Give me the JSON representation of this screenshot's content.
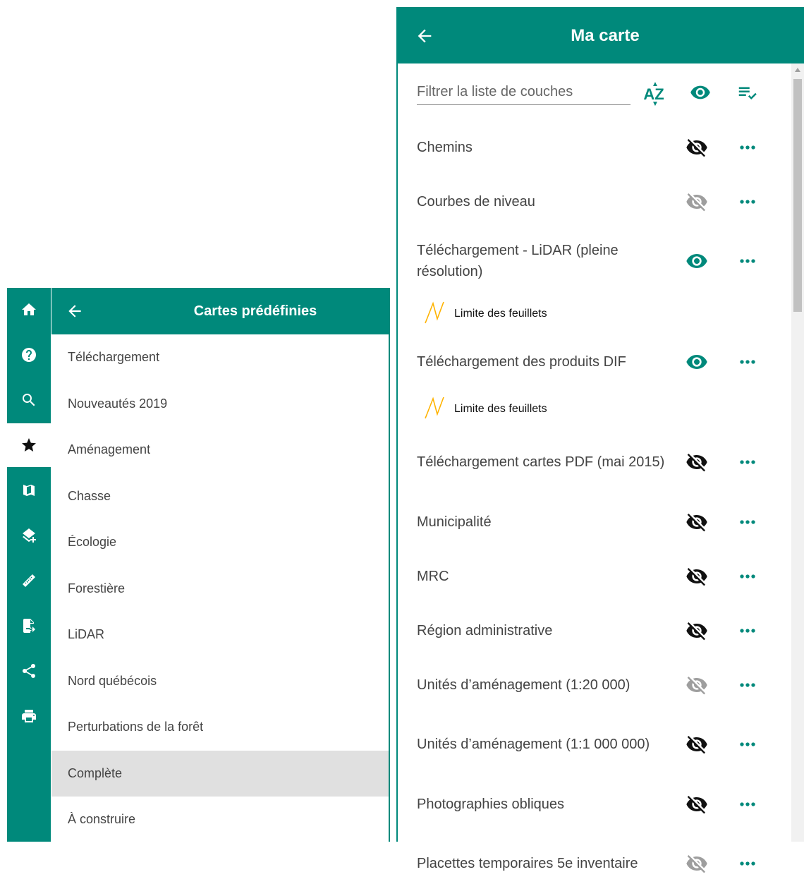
{
  "rail": {
    "items": [
      {
        "icon": "home-icon",
        "active": false
      },
      {
        "icon": "help-icon",
        "active": false
      },
      {
        "icon": "search-icon",
        "active": false
      },
      {
        "icon": "star-icon",
        "active": true
      },
      {
        "icon": "map-icon",
        "active": false
      },
      {
        "icon": "add-layer-icon",
        "active": false
      },
      {
        "icon": "ruler-icon",
        "active": false
      },
      {
        "icon": "export-file-icon",
        "active": false
      },
      {
        "icon": "share-icon",
        "active": false
      },
      {
        "icon": "print-icon",
        "active": false
      }
    ]
  },
  "predefined": {
    "title": "Cartes prédéfinies",
    "items": [
      {
        "label": "Téléchargement"
      },
      {
        "label": "Nouveautés 2019"
      },
      {
        "label": "Aménagement"
      },
      {
        "label": "Chasse"
      },
      {
        "label": "Écologie"
      },
      {
        "label": "Forestière"
      },
      {
        "label": "LiDAR"
      },
      {
        "label": "Nord québécois"
      },
      {
        "label": "Perturbations de la forêt"
      },
      {
        "label": "Complète",
        "selected": true
      },
      {
        "label": "À construire"
      }
    ]
  },
  "mymap": {
    "title": "Ma carte",
    "filter_placeholder": "Filtrer la liste de couches",
    "sort_label": "AZ",
    "layers": [
      {
        "name": "Chemins",
        "visibility": "hidden"
      },
      {
        "name": "Courbes de niveau",
        "visibility": "disabled"
      },
      {
        "name": "Téléchargement - LiDAR (pleine résolution)",
        "visibility": "visible",
        "legend": "Limite des feuillets"
      },
      {
        "name": "Téléchargement des produits DIF",
        "visibility": "visible",
        "legend": "Limite des feuillets"
      },
      {
        "name": "Téléchargement cartes PDF (mai 2015)",
        "visibility": "hidden"
      },
      {
        "name": "Municipalité",
        "visibility": "hidden"
      },
      {
        "name": "MRC",
        "visibility": "hidden"
      },
      {
        "name": "Région administrative",
        "visibility": "hidden"
      },
      {
        "name": "Unités d’aménagement (1:20 000)",
        "visibility": "disabled"
      },
      {
        "name": "Unités d’aménagement (1:1 000 000)",
        "visibility": "hidden"
      },
      {
        "name": "Photographies obliques",
        "visibility": "hidden"
      },
      {
        "name": "Placettes temporaires 5e inventaire",
        "visibility": "disabled"
      }
    ]
  },
  "colors": {
    "accent": "#00897b",
    "hidden_icon": "#111111",
    "disabled_icon": "#9e9e9e",
    "legend_line": "#ffb300",
    "selected_bg": "#e0e0e0"
  }
}
